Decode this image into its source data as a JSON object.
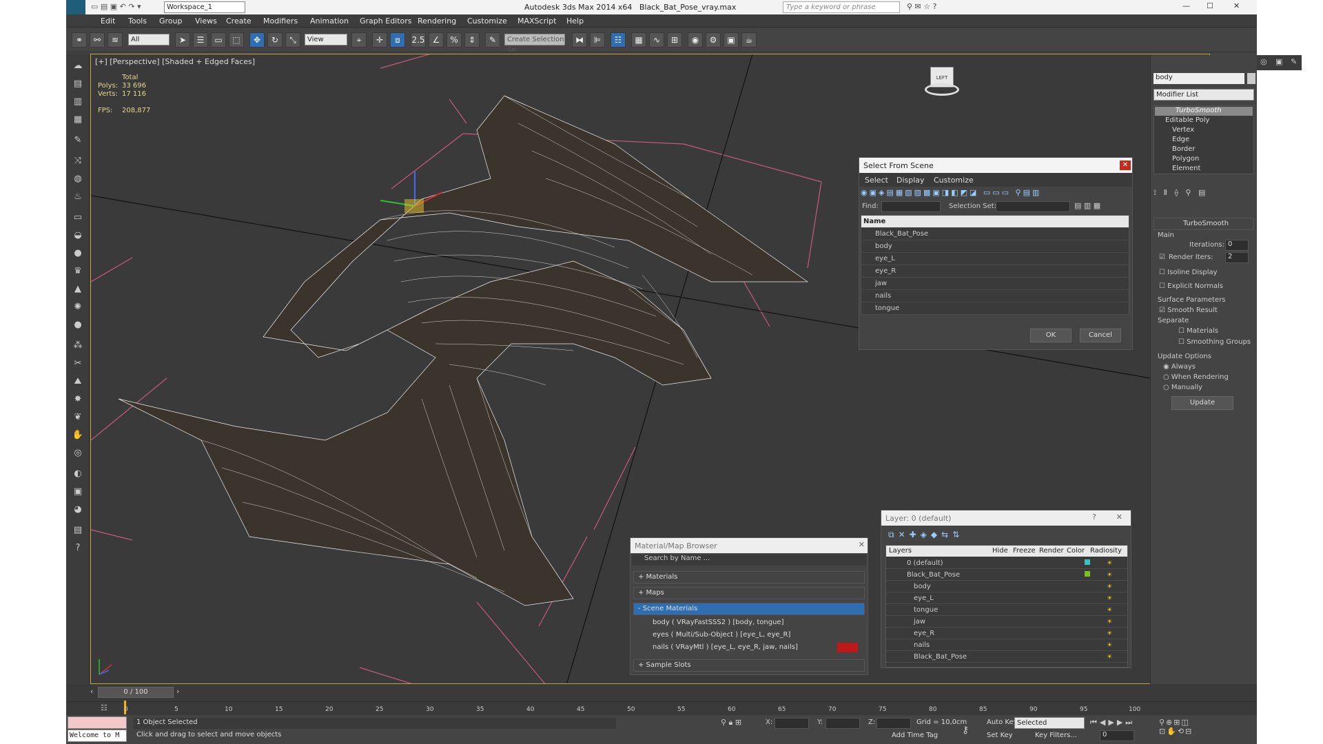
{
  "title": {
    "workspace": "Workspace_1",
    "app_title": "Autodesk 3ds Max  2014 x64",
    "file": "Black_Bat_Pose_vray.max",
    "search_placeholder": "Type a keyword or phrase"
  },
  "menu": [
    "Edit",
    "Tools",
    "Group",
    "Views",
    "Create",
    "Modifiers",
    "Animation",
    "Graph Editors",
    "Rendering",
    "Customize",
    "MAXScript",
    "Help"
  ],
  "toolbar": {
    "filter_select": "All",
    "ref_coord": "View",
    "snap_value": "2.5",
    "selection_set_placeholder": "Create Selection Se"
  },
  "viewport": {
    "label": "[+] [Perspective] [Shaded + Edged Faces]",
    "stats": {
      "total_label": "Total",
      "polys_label": "Polys:",
      "polys_value": "33 696",
      "verts_label": "Verts:",
      "verts_value": "17 116",
      "fps_label": "FPS:",
      "fps_value": "208,877"
    },
    "viewcube_label": "LEFT"
  },
  "command_panel": {
    "object_name": "body",
    "modifier_list": "Modifier List",
    "stack": [
      "TurboSmooth",
      "Editable Poly",
      "Vertex",
      "Edge",
      "Border",
      "Polygon",
      "Element"
    ],
    "rollout_title": "TurboSmooth",
    "main_label": "Main",
    "iterations_label": "Iterations:",
    "iterations_value": "0",
    "render_iters_label": "Render Iters:",
    "render_iters_value": "2",
    "isoline_display": "Isoline Display",
    "explicit_normals": "Explicit Normals",
    "surface_parameters": "Surface Parameters",
    "smooth_result": "Smooth Result",
    "separate": "Separate",
    "materials": "Materials",
    "smoothing_groups": "Smoothing Groups",
    "update_options": "Update Options",
    "always": "Always",
    "when_rendering": "When Rendering",
    "manually": "Manually",
    "update_button": "Update"
  },
  "select_dialog": {
    "title": "Select From Scene",
    "menu": [
      "Select",
      "Display",
      "Customize"
    ],
    "find_label": "Find:",
    "selection_set_label": "Selection Set:",
    "column_name": "Name",
    "items": [
      "Black_Bat_Pose",
      "body",
      "eye_L",
      "eye_R",
      "jaw",
      "nails",
      "tongue"
    ],
    "ok": "OK",
    "cancel": "Cancel"
  },
  "material_browser": {
    "title": "Material/Map Browser",
    "search_placeholder": "Search by Name ...",
    "groups": [
      "+ Materials",
      "+ Maps",
      "- Scene Materials",
      "+ Sample Slots"
    ],
    "materials": [
      "body  ( VRayFastSSS2 ) [body, tongue]",
      "eyes  ( Multi/Sub-Object ) [eye_L, eye_R]",
      "nails  ( VRayMtl ) [eye_L, eye_R, jaw, nails]"
    ]
  },
  "layer_dialog": {
    "title": "Layer: 0 (default)",
    "help": "?",
    "columns": [
      "Layers",
      "Hide",
      "Freeze",
      "Render",
      "Color",
      "Radiosity"
    ],
    "rows": [
      "0 (default)",
      "Black_Bat_Pose",
      "body",
      "eye_L",
      "tongue",
      "jaw",
      "eye_R",
      "nails",
      "Black_Bat_Pose"
    ]
  },
  "timeline": {
    "frame_counter": "0 / 100",
    "ticks": [
      "0",
      "5",
      "10",
      "15",
      "20",
      "25",
      "30",
      "35",
      "40",
      "45",
      "50",
      "55",
      "60",
      "65",
      "70",
      "75",
      "80",
      "85",
      "90",
      "95",
      "100"
    ]
  },
  "status": {
    "listener": "Welcome to M",
    "selected": "1 Object Selected",
    "prompt": "Click and drag to select and move objects",
    "x_label": "X:",
    "y_label": "Y:",
    "z_label": "Z:",
    "grid": "Grid = 10,0cm",
    "add_time_tag": "Add Time Tag",
    "auto_key": "Auto Key",
    "set_key": "Set Key",
    "selected_dd": "Selected",
    "key_filters": "Key Filters...",
    "frame_field": "0"
  },
  "colors": {
    "active_blue": "#2f6fb1",
    "viewport_border": "#c9a23a",
    "stats_yellow": "#e6d88a"
  }
}
